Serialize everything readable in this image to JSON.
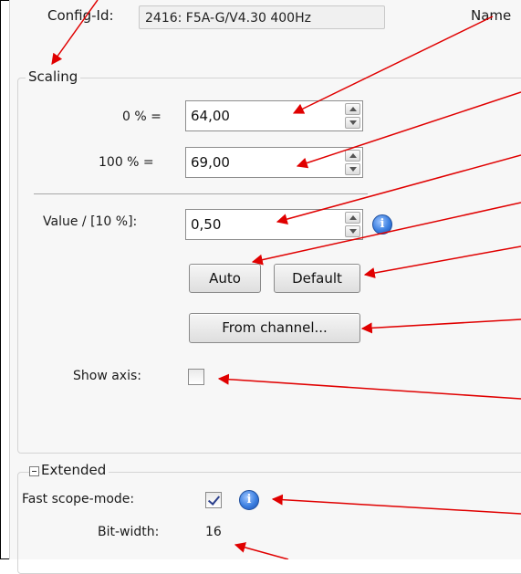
{
  "config": {
    "label": "Config-Id:",
    "value": "2416: F5A-G/V4.30 400Hz",
    "name_label": "Name"
  },
  "scaling": {
    "title": "Scaling",
    "zero_label": "0 % =",
    "zero_value": "64,00",
    "hundred_label": "100 % =",
    "hundred_value": "69,00",
    "value_label": "Value / [10 %]:",
    "value_value": "0,50",
    "auto_button": "Auto",
    "default_button": "Default",
    "from_channel_button": "From channel...",
    "show_axis_label": "Show axis:",
    "show_axis_checked": false
  },
  "extended": {
    "title": "Extended",
    "fast_scope_label": "Fast scope-mode:",
    "fast_scope_checked": true,
    "bit_width_label": "Bit-width:",
    "bit_width_value": "16"
  },
  "icons": {
    "info": "info-icon",
    "collapse": "collapse-minus-icon"
  },
  "colors": {
    "arrow": "#e00000",
    "info_blue": "#3b7fe0",
    "check": "#2a3e8c"
  }
}
